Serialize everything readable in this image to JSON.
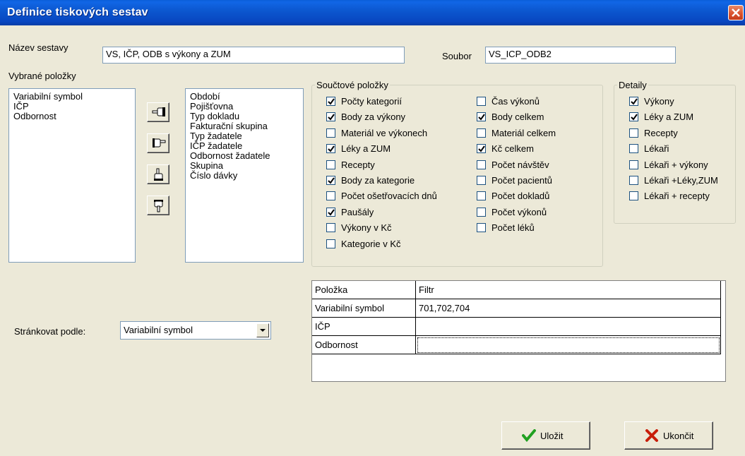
{
  "window": {
    "title": "Definice tiskových sestav"
  },
  "form": {
    "name_label": "Název sestavy",
    "name_value": "VS, IČP, ODB s výkony a ZUM",
    "file_label": "Soubor",
    "file_value": "VS_ICP_ODB2",
    "selected_label": "Vybrané položky"
  },
  "selected_items": [
    "Variabilní symbol",
    "IČP",
    "Odbornost"
  ],
  "available_items": [
    "Období",
    "Pojišťovna",
    "Typ dokladu",
    "Fakturační skupina",
    "Typ žadatele",
    "IČP žadatele",
    "Odbornost žadatele",
    "Skupina",
    "Číslo dávky"
  ],
  "transfer_buttons": [
    {
      "icon": "hand-pointing-left-icon"
    },
    {
      "icon": "hand-pointing-right-icon"
    },
    {
      "icon": "hand-pointing-up-icon"
    },
    {
      "icon": "hand-pointing-down-icon"
    }
  ],
  "sum_group": {
    "legend": "Součtové položky",
    "items": [
      {
        "label": "Počty kategorií",
        "checked": true
      },
      {
        "label": "Body za výkony",
        "checked": true
      },
      {
        "label": "Materiál ve výkonech",
        "checked": false
      },
      {
        "label": "Léky a ZUM",
        "checked": true
      },
      {
        "label": "Recepty",
        "checked": false
      },
      {
        "label": "Body za kategorie",
        "checked": true
      },
      {
        "label": "Počet ošetřovacích dnů",
        "checked": false
      },
      {
        "label": "Paušály",
        "checked": true
      },
      {
        "label": "Výkony v Kč",
        "checked": false
      },
      {
        "label": "Kategorie v Kč",
        "checked": false
      },
      {
        "label": "Čas výkonů",
        "checked": false
      },
      {
        "label": "Body celkem",
        "checked": true
      },
      {
        "label": "Materiál celkem",
        "checked": false
      },
      {
        "label": "Kč celkem",
        "checked": true
      },
      {
        "label": "Počet návštěv",
        "checked": false
      },
      {
        "label": "Počet pacientů",
        "checked": false
      },
      {
        "label": "Počet dokladů",
        "checked": false
      },
      {
        "label": "Počet výkonů",
        "checked": false
      },
      {
        "label": "Počet léků",
        "checked": false
      }
    ]
  },
  "detail_group": {
    "legend": "Detaily",
    "items": [
      {
        "label": "Výkony",
        "checked": true
      },
      {
        "label": "Léky a ZUM",
        "checked": true
      },
      {
        "label": "Recepty",
        "checked": false
      },
      {
        "label": "Lékaři",
        "checked": false
      },
      {
        "label": "Lékaři + výkony",
        "checked": false
      },
      {
        "label": "Lékaři +Léky,ZUM",
        "checked": false
      },
      {
        "label": "Lékaři + recepty",
        "checked": false
      }
    ]
  },
  "paging": {
    "label": "Stránkovat podle:",
    "value": "Variabilní symbol"
  },
  "filter_grid": {
    "headers": [
      "Položka",
      "Filtr"
    ],
    "rows": [
      {
        "item": "Variabilní symbol",
        "filter": "701,702,704"
      },
      {
        "item": "IČP",
        "filter": ""
      },
      {
        "item": "Odbornost",
        "filter": ""
      }
    ]
  },
  "buttons": {
    "save": "Uložit",
    "close": "Ukončit"
  },
  "colors": {
    "titlebar": "#0846c0",
    "dialog": "#ECE9D8",
    "check": "#21a121",
    "cancel_x": "#c81e0a"
  }
}
